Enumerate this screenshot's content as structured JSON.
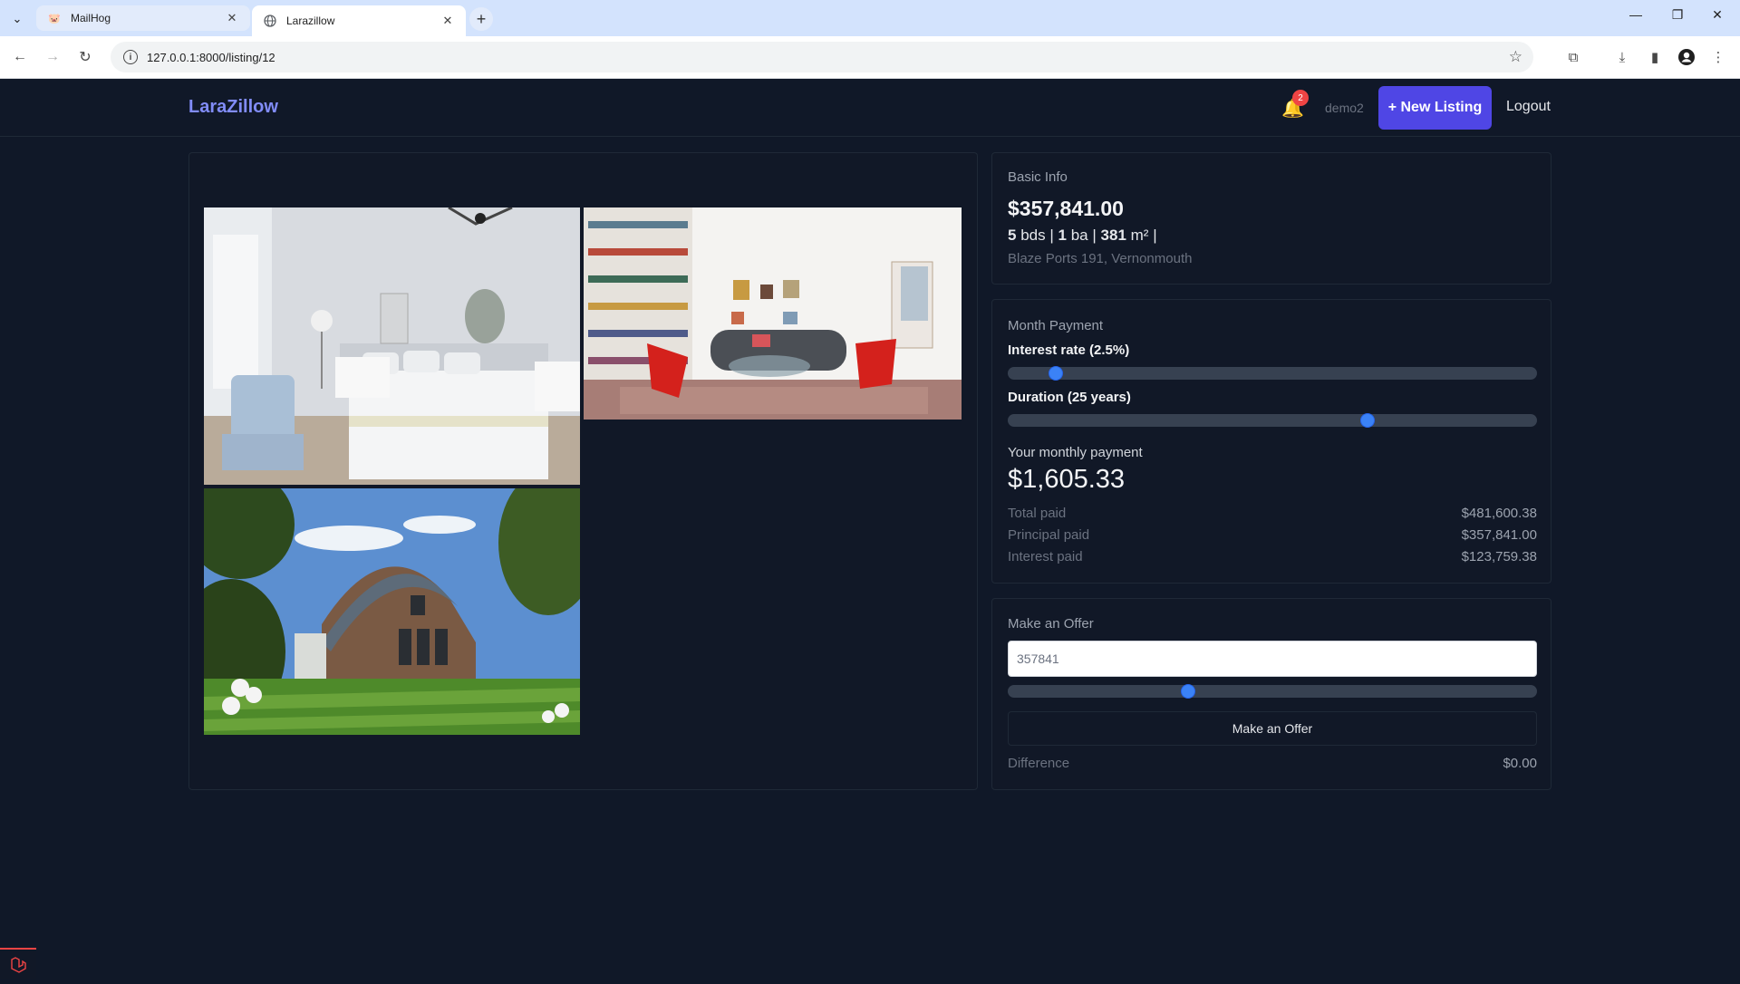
{
  "browser": {
    "tabs": [
      {
        "title": "MailHog",
        "active": false
      },
      {
        "title": "Larazillow",
        "active": true
      }
    ],
    "url": "127.0.0.1:8000/listing/12"
  },
  "header": {
    "logo": "LaraZillow",
    "notification_count": "2",
    "username": "demo2",
    "new_listing_label": "+ New Listing",
    "logout_label": "Logout"
  },
  "gallery": {
    "images": [
      {
        "name": "bedroom-photo",
        "scene": "bedroom"
      },
      {
        "name": "living-room-photo",
        "scene": "living room"
      },
      {
        "name": "house-exterior-photo",
        "scene": "house exterior"
      }
    ]
  },
  "basic_info": {
    "title": "Basic Info",
    "price": "$357,841.00",
    "beds": "5",
    "beds_unit": "bds",
    "baths": "1",
    "baths_unit": "ba",
    "area": "381",
    "area_unit": "m²",
    "address": "Blaze Ports 191, Vernonmouth"
  },
  "mortgage": {
    "title": "Month Payment",
    "interest_label": "Interest rate (2.5%)",
    "interest_fraction": 0.09,
    "duration_label": "Duration (25 years)",
    "duration_fraction": 0.68,
    "monthly_label": "Your monthly payment",
    "monthly_value": "$1,605.33",
    "total_paid_label": "Total paid",
    "total_paid": "$481,600.38",
    "principal_paid_label": "Principal paid",
    "principal_paid": "$357,841.00",
    "interest_paid_label": "Interest paid",
    "interest_paid": "$123,759.38"
  },
  "offer": {
    "title": "Make an Offer",
    "input_value": "357841",
    "slider_fraction": 0.34,
    "button_label": "Make an Offer",
    "difference_label": "Difference",
    "difference_value": "$0.00"
  },
  "colors": {
    "background": "#101828",
    "accent": "#4f46e5",
    "logo": "#818cf8",
    "slider_thumb": "#3b82f6"
  }
}
